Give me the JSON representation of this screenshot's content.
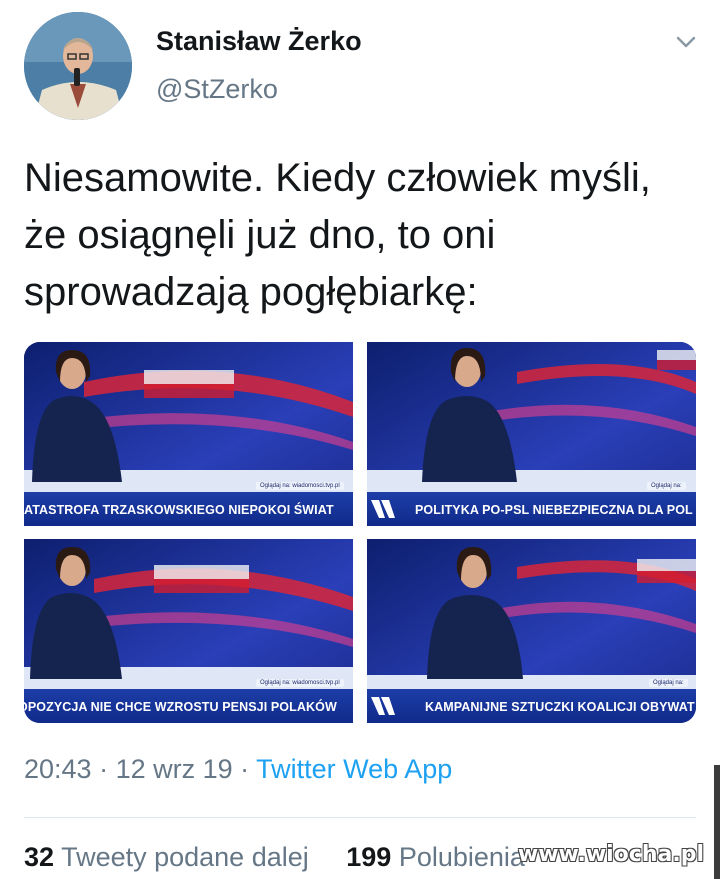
{
  "author": {
    "name": "Stanisław Żerko",
    "handle": "@StZerko"
  },
  "tweet": {
    "text": "Niesamowite. Kiedy człowiek myśli, że osiągnęli już dno, to oni sprowadzają pogłębiarkę:"
  },
  "media": [
    {
      "ticker": "ATASTROFA TRZASKOWSKIEGO NIEPOKOI ŚWIAT",
      "watch": "Oglądaj na: wiadomosci.tvp.pl"
    },
    {
      "ticker": "POLITYKA PO-PSL NIEBEZPIECZNA DLA POL",
      "watch": "Oglądaj na:"
    },
    {
      "ticker": "OPOZYCJA NIE CHCE WZROSTU PENSJI POLAKÓW",
      "watch": "Oglądaj na: wiadomosci.tvp.pl"
    },
    {
      "ticker": "KAMPANIJNE SZTUCZKI KOALICJI OBYWAT",
      "watch": "Oglądaj na:"
    }
  ],
  "meta": {
    "time": "20:43",
    "sep1": " · ",
    "date": "12 wrz 19",
    "sep2": " · ",
    "app": "Twitter Web App"
  },
  "stats": {
    "retweets_count": "32",
    "retweets_label": "Tweety podane dalej",
    "likes_count": "199",
    "likes_label": "Polubienia"
  },
  "watermark": "www.wiocha.pl",
  "icons": {
    "chevron": "chevron-down-icon",
    "tvp_logo": "tvp-logo-icon"
  },
  "colors": {
    "link_blue": "#1da1f2",
    "secondary_text": "#657786",
    "ticker_blue": "#1d3ea8"
  }
}
